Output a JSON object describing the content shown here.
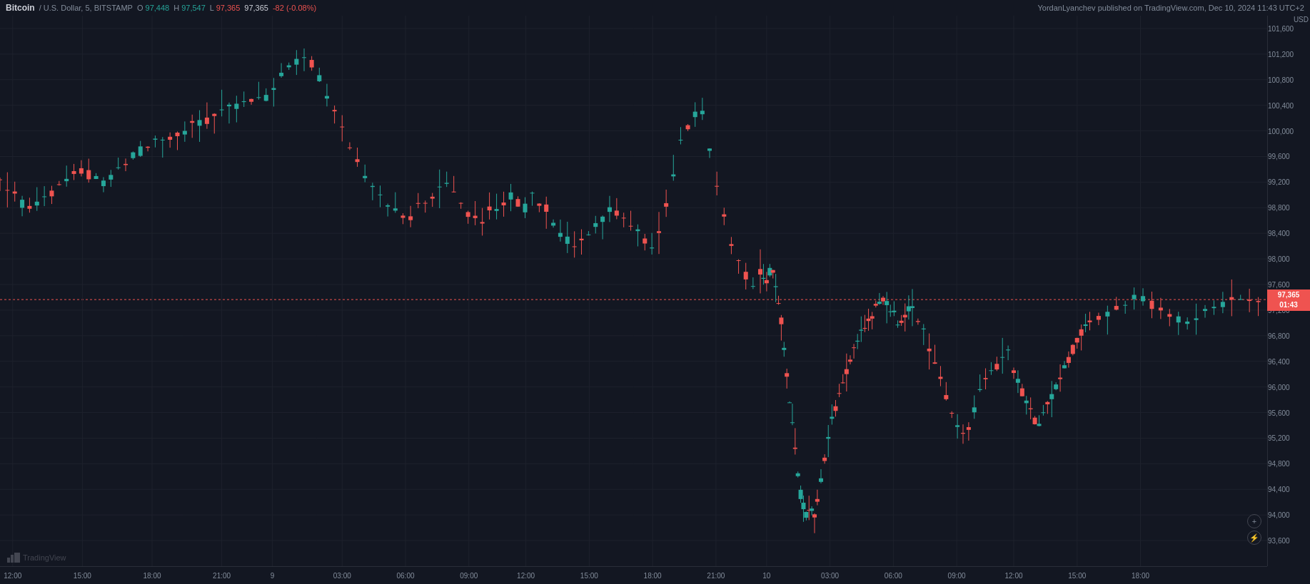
{
  "header": {
    "publisher": "YordanLyanchev published on TradingView.com, Dec 10, 2024 11:43 UTC+2",
    "symbol": "Bitcoin",
    "pair": "/ U.S. Dollar, 5, BITSTAMP",
    "price_o_label": "O",
    "price_h_label": "H",
    "price_l_label": "L",
    "price_o": "97,448",
    "price_h": "97,547",
    "price_l": "97,365",
    "price_c": "97,365",
    "change": "-82",
    "change_pct": "(-0.08%)"
  },
  "price_axis": {
    "currency": "USD",
    "labels": [
      "101,600",
      "101,200",
      "100,800",
      "100,400",
      "100,000",
      "99,600",
      "99,200",
      "98,800",
      "98,400",
      "98,000",
      "97,600",
      "97,200",
      "96,800",
      "96,400",
      "96,000",
      "95,600",
      "95,200",
      "94,800",
      "94,400",
      "94,000",
      "93,600"
    ],
    "current_price": "97,365",
    "current_time": "01:43"
  },
  "time_axis": {
    "labels": [
      "12:00",
      "15:00",
      "18:00",
      "21:00",
      "9",
      "03:00",
      "06:00",
      "09:00",
      "12:00",
      "15:00",
      "18:00",
      "21:00",
      "10",
      "03:00",
      "06:00",
      "09:00",
      "12:00",
      "15:00",
      "18:00"
    ]
  },
  "watermark": {
    "logo_text": "TradingView"
  },
  "interactive_buttons": [
    {
      "name": "zoom-in-icon",
      "symbol": "+"
    },
    {
      "name": "zoom-out-icon",
      "symbol": "⚡"
    }
  ],
  "chart": {
    "bg_color": "#131722",
    "grid_color": "#1e222d",
    "up_color": "#26a69a",
    "down_color": "#ef5350",
    "current_price_line_color": "#ef5350"
  }
}
